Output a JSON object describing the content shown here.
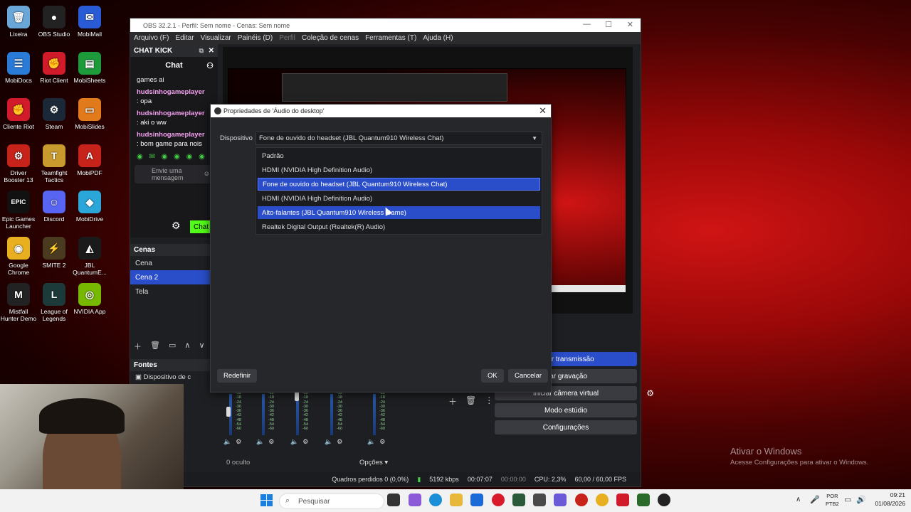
{
  "desktop": {
    "icons": [
      {
        "label": "Lixeira",
        "glyph": "🗑",
        "color": "#6aa6d8"
      },
      {
        "label": "OBS Studio",
        "glyph": "●",
        "color": "#222222"
      },
      {
        "label": "MobiMail",
        "glyph": "✉",
        "color": "#2a5bd7"
      },
      {
        "label": "MobiDocs",
        "glyph": "☰",
        "color": "#2a7ad7"
      },
      {
        "label": "Riot Client",
        "glyph": "✊",
        "color": "#d11a2a"
      },
      {
        "label": "MobiSheets",
        "glyph": "▤",
        "color": "#1d9b3a"
      },
      {
        "label": "Cliente Riot",
        "glyph": "✊",
        "color": "#d11a2a"
      },
      {
        "label": "Steam",
        "glyph": "⚙",
        "color": "#1b2838"
      },
      {
        "label": "MobiSlides",
        "glyph": "▭",
        "color": "#e07a1a"
      },
      {
        "label": "Driver Booster 13",
        "glyph": "⚙",
        "color": "#c8231b"
      },
      {
        "label": "Teamfight Tactics",
        "glyph": "T",
        "color": "#c99a2e"
      },
      {
        "label": "MobiPDF",
        "glyph": "A",
        "color": "#c8231b"
      },
      {
        "label": "Epic Games Launcher",
        "glyph": "EPIC",
        "color": "#111111"
      },
      {
        "label": "Discord",
        "glyph": "☺",
        "color": "#5865f2"
      },
      {
        "label": "MobiDrive",
        "glyph": "◆",
        "color": "#2aa6d8"
      },
      {
        "label": "Google Chrome",
        "glyph": "◉",
        "color": "#e8b020"
      },
      {
        "label": "SMITE 2",
        "glyph": "⚡",
        "color": "#4a3a20"
      },
      {
        "label": "JBL QuantumE...",
        "glyph": "◭",
        "color": "#1a1a1a"
      },
      {
        "label": "Mistfall Hunter Demo",
        "glyph": "M",
        "color": "#222222"
      },
      {
        "label": "League of Legends",
        "glyph": "L",
        "color": "#1c3a3a"
      },
      {
        "label": "NVIDIA App",
        "glyph": "◎",
        "color": "#76b900"
      }
    ]
  },
  "obs": {
    "title": "OBS 32.2.1 - Perfil: Sem nome - Cenas: Sem nome",
    "menu": [
      "Arquivo (F)",
      "Editar",
      "Visualizar",
      "Painéis (D)",
      "Perfil",
      "Coleção de cenas",
      "Ferramentas (T)",
      "Ajuda (H)"
    ],
    "chat_dock_title": "CHAT KICK",
    "chat_header": "Chat",
    "chat_messages": [
      {
        "user": "",
        "text": "games ai"
      },
      {
        "user": "hudsinhogameplayer",
        "text": ": opa"
      },
      {
        "user": "hudsinhogameplayer",
        "text": ": aki o ww"
      },
      {
        "user": "hudsinhogameplayer",
        "text": ": bom game para nois"
      }
    ],
    "chat_input_placeholder": "Envie uma mensagem",
    "chat_button": "Chat",
    "scenes_title": "Cenas",
    "scenes": [
      "Cena",
      "Cena 2",
      "Tela"
    ],
    "selected_scene": "Cena 2",
    "sources_title": "Fontes",
    "source_item": "Dispositivo de c",
    "controls": [
      "Iniciar transmissão",
      "Iniciar gravação",
      "Iniciar câmera virtual",
      "Modo estúdio",
      "Configurações"
    ],
    "controls_visible": [
      "mper transmissão",
      "ciar gravação",
      "Iniciar câmera virtual",
      "Modo estúdio",
      "Configurações"
    ],
    "hidden_label": "0 oculto",
    "options_label": "Opções",
    "status": {
      "dropped_frames": "Quadros perdidos 0 (0,0%)",
      "bitrate": "5192 kbps",
      "stream_time": "00:07:07",
      "rec_time": "00:00:00",
      "cpu": "CPU: 2,3%",
      "fps": "60,00 / 60,00 FPS"
    }
  },
  "dialog": {
    "title": "Propriedades de 'Áudio do desktop'",
    "device_label": "Dispositivo",
    "selected_device": "Fone de ouvido do headset (JBL Quantum910 Wireless Chat)",
    "options": [
      "Padrão",
      "HDMI (NVIDIA High Definition Audio)",
      "Fone de ouvido do headset (JBL Quantum910 Wireless Chat)",
      "HDMI (NVIDIA High Definition Audio)",
      "Alto-falantes (JBL Quantum910 Wireless Game)",
      "Realtek Digital Output (Realtek(R) Audio)"
    ],
    "hovered_option": "Alto-falantes (JBL Quantum910 Wireless Game)",
    "reset_button": "Redefinir",
    "ok_button": "OK",
    "cancel_button": "Cancelar"
  },
  "mixer": {
    "scale": [
      "-12",
      "-18",
      "-24",
      "-30",
      "-36",
      "-42",
      "-48",
      "-54",
      "-60"
    ]
  },
  "watermark": {
    "title": "Ativar o Windows",
    "subtitle": "Acesse Configurações para ativar o Windows."
  },
  "taskbar": {
    "search_placeholder": "Pesquisar",
    "lang": "POR",
    "layout": "PTB2",
    "time": "09:21",
    "date": "01/08/2026"
  }
}
